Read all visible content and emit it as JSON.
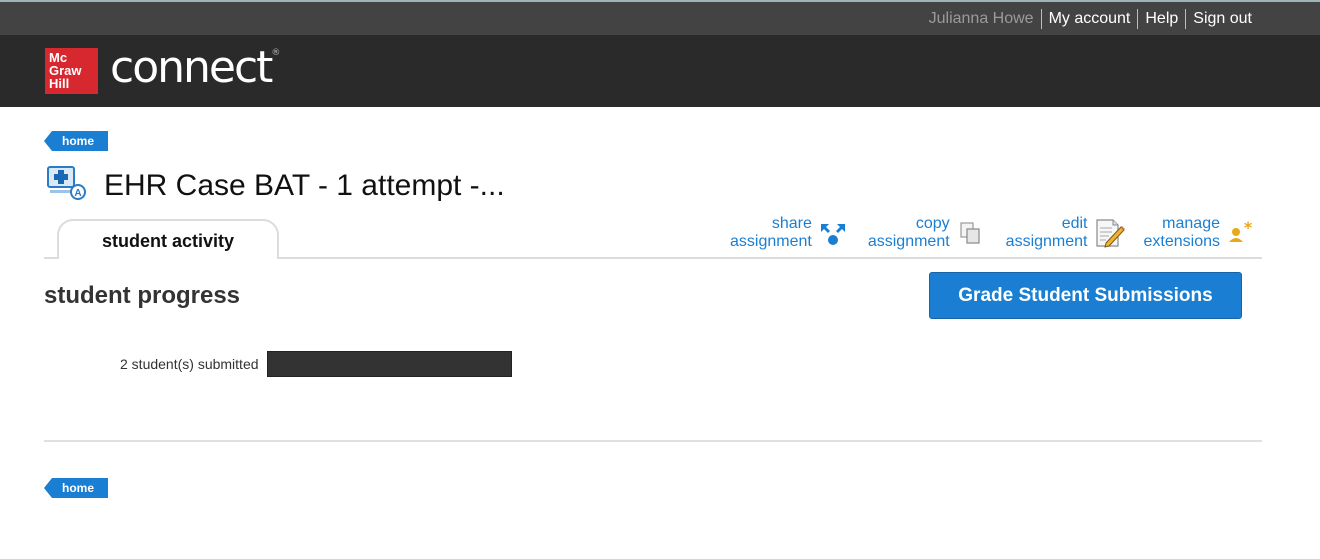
{
  "topbar": {
    "user_name": "Julianna Howe",
    "links": [
      "My account",
      "Help",
      "Sign out"
    ]
  },
  "brand": {
    "logo_lines": [
      "Mc",
      "Graw",
      "Hill"
    ],
    "product": "connect",
    "registered": "®",
    "colors": {
      "logo_red": "#d7282f",
      "accent_blue": "#1a7fd3"
    }
  },
  "breadcrumb": {
    "home_label": "home"
  },
  "assignment": {
    "icon": "ehr-assignment-icon",
    "title": "EHR Case BAT - 1 attempt -..."
  },
  "tabs": [
    {
      "label": "student activity",
      "active": true
    }
  ],
  "actions": [
    {
      "line1": "share",
      "line2": "assignment",
      "icon": "share-icon"
    },
    {
      "line1": "copy",
      "line2": "assignment",
      "icon": "copy-icon"
    },
    {
      "line1": "edit",
      "line2": "assignment",
      "icon": "edit-icon"
    },
    {
      "line1": "manage",
      "line2": "extensions",
      "icon": "extensions-icon"
    }
  ],
  "progress": {
    "heading": "student progress",
    "grade_button": "Grade Student Submissions",
    "submitted_label": "2 student(s) submitted",
    "submitted_count": 2
  },
  "footer": {
    "home_label": "home"
  }
}
